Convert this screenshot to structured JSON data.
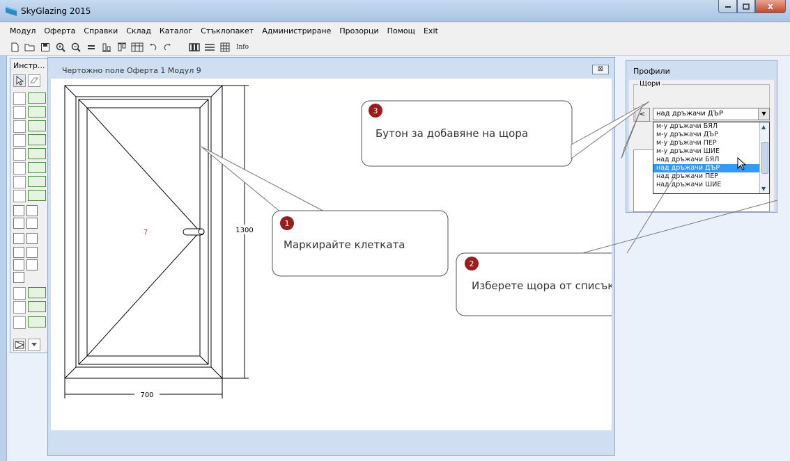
{
  "window": {
    "title": "SkyGlazing 2015",
    "close_glyph": "x"
  },
  "menu": [
    "Модул",
    "Оферта",
    "Справки",
    "Склад",
    "Каталог",
    "Стъклопакет",
    "Администриране",
    "Прозорци",
    "Помощ",
    "Exit"
  ],
  "toolbar": {
    "info_label": "Info"
  },
  "tools": {
    "title": "Инстр..."
  },
  "drawing": {
    "title": "Чертожно поле  Оферта 1  Модул 9",
    "close_glyph": "⊠",
    "cell_number": "7",
    "width_label": "700",
    "height_label": "1300"
  },
  "profiles": {
    "title": "Профили",
    "group_label": "Щори",
    "add_button": "<",
    "combo_value": "над дръжачи ДЪР",
    "dropdown_items": [
      "м-у дръжачи БЯЛ",
      "м-у дръжачи ДЪР",
      "м-у дръжачи ПЕР",
      "м-у дръжачи ШИЕ",
      "над дръжачи БЯЛ",
      "над дръжачи ДЪР",
      "над дръжачи ПЕР",
      "над дръжачи ШИЕ"
    ],
    "selected_index": 5
  },
  "callouts": [
    {
      "number": "1",
      "text": "Маркирайте клетката"
    },
    {
      "number": "2",
      "text": "Изберете щора от списъка"
    },
    {
      "number": "3",
      "text": "Бутон за добавяне на щора"
    }
  ],
  "colors": {
    "callout_badge": "#9b1c1c",
    "selection": "#3399ff",
    "cell_number": "#c0392b"
  },
  "icons": [
    "app-icon",
    "new-icon",
    "open-icon",
    "save-icon",
    "zoom-in-icon",
    "zoom-out-icon",
    "undo-icon",
    "redo-icon",
    "arrow-pointer-icon",
    "eraser-icon",
    "mouse-cursor-icon"
  ]
}
